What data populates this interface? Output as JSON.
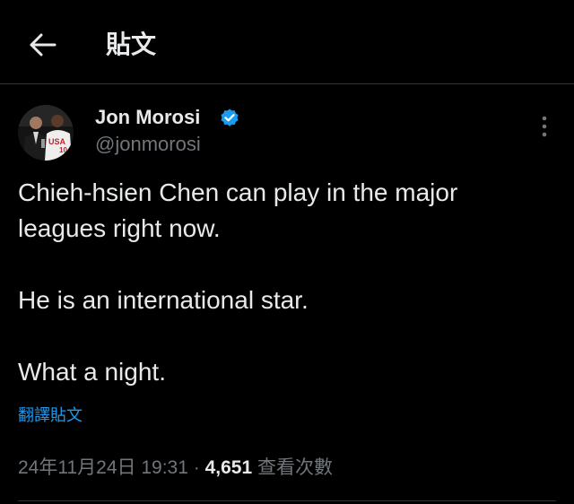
{
  "header": {
    "back_icon": "arrow-left-icon",
    "title": "貼文"
  },
  "tweet": {
    "author_name": "Jon Morosi",
    "verified_icon": "verified-badge-icon",
    "verified_color": "#1d9bf0",
    "handle": "@jonmorosi",
    "more_icon": "more-vertical-icon",
    "text": {
      "paragraph_1_line_1": "Chieh-hsien Chen can play in the major",
      "paragraph_1_line_2": "leagues right now.",
      "paragraph_2": "He is an international star.",
      "paragraph_3": "What a night."
    },
    "translate_label": "翻譯貼文",
    "timestamp": "24年11月24日 19:31",
    "separator": " · ",
    "view_count": "4,651",
    "view_label": "查看次數"
  },
  "colors": {
    "background": "#000000",
    "primary_text": "#e7e9ea",
    "secondary_text": "#71767b",
    "link": "#1d9bf0",
    "divider": "#2f3336"
  }
}
